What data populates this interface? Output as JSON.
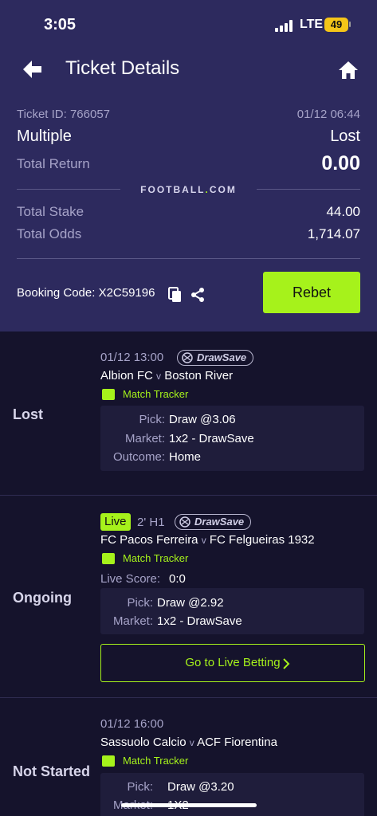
{
  "status_bar": {
    "time": "3:05",
    "network": "LTE",
    "battery": "49"
  },
  "header": {
    "title": "Ticket Details",
    "back_icon": "arrow-left-icon",
    "home_icon": "home-icon"
  },
  "summary": {
    "ticket_id": "Ticket ID: 766057",
    "datetime": "01/12 06:44",
    "bet_type": "Multiple",
    "result": "Lost",
    "total_return_label": "Total Return",
    "total_return_value": "0.00",
    "brand_left": "FOOTBALL",
    "brand_dot": ".",
    "brand_right": "COM",
    "total_stake_label": "Total Stake",
    "total_stake_value": "44.00",
    "total_odds_label": "Total Odds",
    "total_odds_value": "1,714.07",
    "booking_code": "Booking Code: X2C59196",
    "rebet_label": "Rebet"
  },
  "bets": [
    {
      "status": "Lost",
      "datetime": "01/12 13:00",
      "badge": "DrawSave",
      "home": "Albion FC",
      "away": "Boston River",
      "vs": "v",
      "tracker": "Match Tracker",
      "pick_label": "Pick:",
      "pick_value": "Draw @3.06",
      "market_label": "Market:",
      "market_value": "1x2 - DrawSave",
      "outcome_label": "Outcome:",
      "outcome_value": "Home"
    },
    {
      "status": "Ongoing",
      "live": "Live",
      "minute": "2' H1",
      "badge": "DrawSave",
      "home": "FC Pacos Ferreira",
      "away": "FC Felgueiras 1932",
      "vs": "v",
      "tracker": "Match Tracker",
      "live_score_label": "Live Score:",
      "live_score_value": "0:0",
      "pick_label": "Pick:",
      "pick_value": "Draw @2.92",
      "market_label": "Market:",
      "market_value": "1x2 - DrawSave",
      "go_live_label": "Go to Live Betting"
    },
    {
      "status": "Not Started",
      "datetime": "01/12 16:00",
      "home": "Sassuolo Calcio",
      "away": "ACF Fiorentina",
      "vs": "v",
      "tracker": "Match Tracker",
      "pick_label": "Pick:",
      "pick_value": "Draw @3.20",
      "market_label": "Market:",
      "market_value": "1X2"
    }
  ],
  "colors": {
    "accent": "#a6f21b",
    "header_bg": "#2d2a5e",
    "page_bg": "#15132c"
  }
}
